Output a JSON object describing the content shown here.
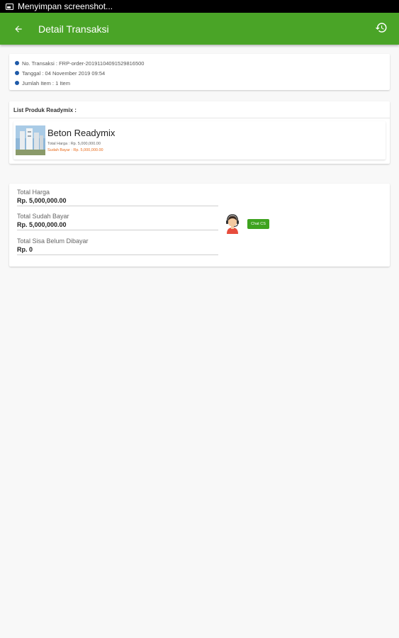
{
  "status_bar": {
    "text": "Menyimpan screenshot..."
  },
  "app_bar": {
    "title": "Detail Transaksi",
    "back_icon": "arrow-left-icon",
    "history_icon": "history-icon",
    "color": "#4aa427"
  },
  "info": {
    "items": [
      "No. Transaksi : FRP-order-20191104091529816500",
      "Tanggal : 04 November 2019 09:54",
      "Jumlah Item : 1 Item"
    ]
  },
  "products": {
    "header": "List Produk Readymix :",
    "items": [
      {
        "name": "Beton Readymix",
        "price": "Total Harga : Rp. 5,000,000.00",
        "paid": "Sudah Bayar : Rp. 5,000,000.00"
      }
    ]
  },
  "summary": {
    "rows": [
      {
        "label": "Total Harga",
        "value": "Rp. 5,000,000.00"
      },
      {
        "label": "Total Sudah Bayar",
        "value": "Rp. 5,000,000.00"
      },
      {
        "label": "Total Sisa Belum Dibayar",
        "value": "Rp. 0"
      }
    ],
    "chat_button": "Chat CS",
    "accent": "#3ea31f"
  }
}
